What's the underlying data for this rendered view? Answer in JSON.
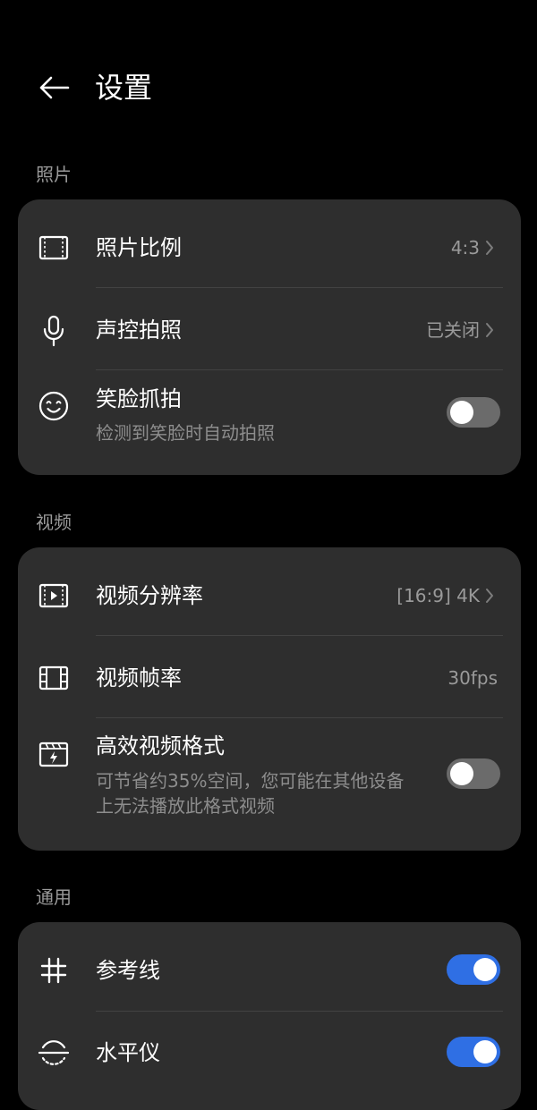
{
  "header": {
    "title": "设置",
    "back_icon": "back-arrow-icon"
  },
  "sections": {
    "photo": {
      "title": "照片",
      "aspect_ratio": {
        "label": "照片比例",
        "value": "4:3",
        "icon": "aspect-ratio-icon"
      },
      "voice_capture": {
        "label": "声控拍照",
        "value": "已关闭",
        "icon": "microphone-icon"
      },
      "smile_capture": {
        "label": "笑脸抓拍",
        "subtitle": "检测到笑脸时自动拍照",
        "icon": "smile-icon",
        "enabled": false
      }
    },
    "video": {
      "title": "视频",
      "resolution": {
        "label": "视频分辨率",
        "value": "[16:9] 4K",
        "icon": "video-resolution-icon"
      },
      "frame_rate": {
        "label": "视频帧率",
        "value": "30fps",
        "icon": "film-strip-icon"
      },
      "efficient_format": {
        "label": "高效视频格式",
        "subtitle": "可节省约35%空间，您可能在其他设备上无法播放此格式视频",
        "icon": "efficient-format-icon",
        "enabled": false
      }
    },
    "general": {
      "title": "通用",
      "grid_lines": {
        "label": "参考线",
        "icon": "grid-icon",
        "enabled": true
      },
      "level": {
        "label": "水平仪",
        "icon": "level-icon",
        "enabled": true
      }
    }
  },
  "colors": {
    "background": "#000000",
    "card": "#2e2e2e",
    "toggle_on": "#2f6fe4",
    "toggle_off": "#6b6b6b",
    "secondary_text": "#9a9a9a"
  }
}
